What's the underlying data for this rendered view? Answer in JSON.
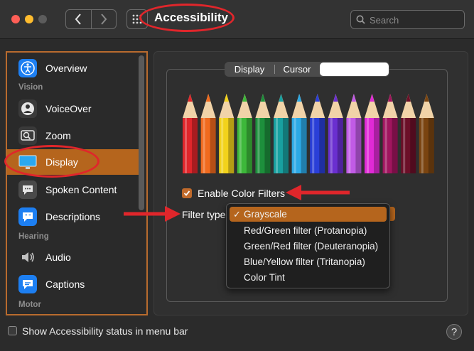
{
  "window": {
    "title": "Accessibility"
  },
  "search": {
    "placeholder": "Search"
  },
  "sidebar": {
    "items": [
      {
        "label": "Overview"
      },
      {
        "label": "VoiceOver"
      },
      {
        "label": "Zoom"
      },
      {
        "label": "Display",
        "selected": true
      },
      {
        "label": "Spoken Content"
      },
      {
        "label": "Descriptions"
      },
      {
        "label": "Audio"
      },
      {
        "label": "Captions"
      }
    ],
    "headers": {
      "vision": "Vision",
      "hearing": "Hearing",
      "motor": "Motor"
    }
  },
  "tabs": {
    "display": "Display",
    "cursor": "Cursor"
  },
  "color_filters": {
    "enable_label": "Enable Color Filters",
    "enabled": true,
    "filter_type_label": "Filter type",
    "options": [
      "Grayscale",
      "Red/Green filter (Protanopia)",
      "Green/Red filter (Deuteranopia)",
      "Blue/Yellow filter (Tritanopia)",
      "Color Tint"
    ],
    "selected": "Grayscale"
  },
  "pencil_colors": [
    "#e0262b",
    "#f06a1e",
    "#f2d21b",
    "#3db83a",
    "#1d8f3c",
    "#18a0a0",
    "#2ca9e6",
    "#2a3fd8",
    "#6a2fd0",
    "#c15be6",
    "#e02ad6",
    "#a0155e",
    "#6b0f28",
    "#7a4410"
  ],
  "bottom": {
    "status_label": "Show Accessibility status in menu bar",
    "help": "?"
  },
  "colors": {
    "accent": "#b5651d",
    "annotation": "#e0262b"
  }
}
